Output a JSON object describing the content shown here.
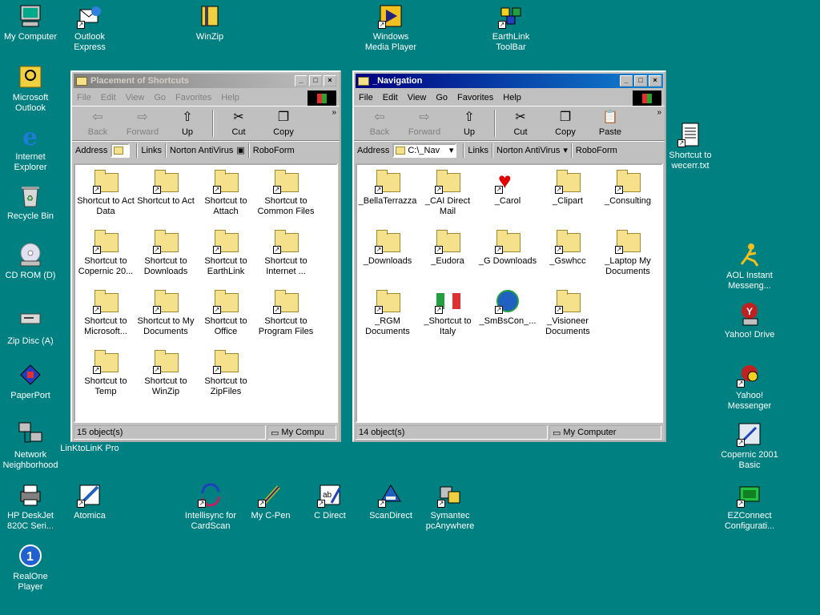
{
  "desktop": {
    "icons": [
      {
        "label": "My Computer",
        "icon": "computer-icon"
      },
      {
        "label": "Outlook Express",
        "icon": "mail-icon"
      },
      {
        "label": "WinZip",
        "icon": "winzip-icon"
      },
      {
        "label": "Windows Media Player",
        "icon": "media-player-icon"
      },
      {
        "label": "EarthLink ToolBar",
        "icon": "earthlink-icon"
      },
      {
        "label": "Microsoft Outlook",
        "icon": "outlook-icon"
      },
      {
        "label": "Internet Explorer",
        "icon": "ie-icon"
      },
      {
        "label": "Recycle Bin",
        "icon": "recycle-bin-icon"
      },
      {
        "label": "CD ROM (D)",
        "icon": "cdrom-icon"
      },
      {
        "label": "Zip Disc (A)",
        "icon": "zip-drive-icon"
      },
      {
        "label": "PaperPort",
        "icon": "paperport-icon"
      },
      {
        "label": "Network Neighborhood",
        "icon": "network-icon"
      },
      {
        "label": "LinKtoLinK Pro",
        "icon": "link-icon"
      },
      {
        "label": "HP DeskJet 820C Seri...",
        "icon": "printer-icon"
      },
      {
        "label": "Atomica",
        "icon": "atomica-icon"
      },
      {
        "label": "Intellisync for CardScan",
        "icon": "sync-icon"
      },
      {
        "label": "My C-Pen",
        "icon": "pen-icon"
      },
      {
        "label": "C Direct",
        "icon": "cdirect-icon"
      },
      {
        "label": "ScanDirect",
        "icon": "scan-icon"
      },
      {
        "label": "Symantec pcAnywhere",
        "icon": "pcanywhere-icon"
      },
      {
        "label": "RealOne Player",
        "icon": "realone-icon"
      },
      {
        "label": "Shortcut to wecerr.txt",
        "icon": "text-file-icon"
      },
      {
        "label": "AOL Instant Messeng...",
        "icon": "aim-icon"
      },
      {
        "label": "Yahoo! Drive",
        "icon": "yahoo-drive-icon"
      },
      {
        "label": "Yahoo! Messenger",
        "icon": "yahoo-messenger-icon"
      },
      {
        "label": "Copernic 2001 Basic",
        "icon": "copernic-icon"
      },
      {
        "label": "EZConnect Configurati...",
        "icon": "ezconnect-icon"
      }
    ]
  },
  "win1": {
    "title": "Placement of Shortcuts",
    "menu": [
      "File",
      "Edit",
      "View",
      "Go",
      "Favorites",
      "Help"
    ],
    "toolbar": [
      "Back",
      "Forward",
      "Up",
      "Cut",
      "Copy"
    ],
    "address_label": "Address",
    "links_label": "Links",
    "link1": "Norton AntiVirus",
    "link2": "RoboForm",
    "items": [
      "Shortcut to Act Data",
      "Shortcut to Act",
      "Shortcut to Attach",
      "Shortcut to Common Files",
      "Shortcut to Copernic 20...",
      "Shortcut to Downloads",
      "Shortcut to EarthLink",
      "Shortcut to Internet ...",
      "Shortcut to Microsoft...",
      "Shortcut to My Documents",
      "Shortcut to Office",
      "Shortcut to Program Files",
      "Shortcut to Temp",
      "Shortcut to WinZip",
      "Shortcut to ZipFiles"
    ],
    "status_count": "15 object(s)",
    "status_loc": "My Compu"
  },
  "win2": {
    "title": "_Navigation",
    "menu": [
      "File",
      "Edit",
      "View",
      "Go",
      "Favorites",
      "Help"
    ],
    "toolbar": [
      "Back",
      "Forward",
      "Up",
      "Cut",
      "Copy",
      "Paste"
    ],
    "address_label": "Address",
    "address_value": "C:\\_Nav",
    "links_label": "Links",
    "link1": "Norton AntiVirus",
    "link2": "RoboForm",
    "items": [
      "_BellaTerrazza",
      "_CAI Direct Mail",
      "_Carol",
      "_Clipart",
      "_Consulting",
      "_Downloads",
      "_Eudora",
      "_G Downloads",
      "_Gswhcc",
      "_Laptop My Documents",
      "_RGM Documents",
      "_Shortcut to Italy",
      "_SmBsCon_...",
      "_Visioneer Documents"
    ],
    "status_count": "14 object(s)",
    "status_loc": "My Computer"
  },
  "colors": {
    "desktop": "#008080",
    "active_title": "#000080",
    "face": "#c0c0c0"
  }
}
